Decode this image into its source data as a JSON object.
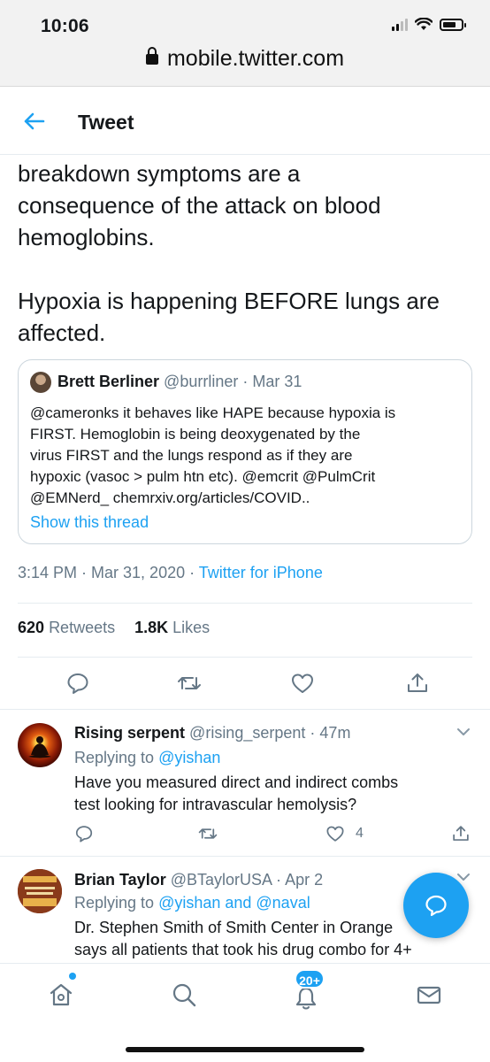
{
  "status_bar": {
    "time": "10:06"
  },
  "browser": {
    "url": "mobile.twitter.com"
  },
  "header": {
    "title": "Tweet"
  },
  "tweet": {
    "text": "breakdown symptoms are a\nconsequence of the attack on blood\nhemoglobins.\n\nHypoxia is happening BEFORE lungs are\naffected.",
    "quote": {
      "name": "Brett Berliner",
      "handle": "@burrliner",
      "date": "Mar 31",
      "text": "@cameronks it behaves like HAPE because hypoxia is\nFIRST.  Hemoglobin is being deoxygenated by the\nvirus FIRST and the lungs respond as if they are\nhypoxic (vasoc > pulm htn etc).  @emcrit @PulmCrit\n@EMNerd_ chemrxiv.org/articles/COVID..",
      "show_thread": "Show this thread"
    },
    "timestamp": "3:14 PM · Mar 31, 2020 · ",
    "source": "Twitter for iPhone",
    "retweets_count": "620",
    "retweets_label": "Retweets",
    "likes_count": "1.8K",
    "likes_label": "Likes"
  },
  "replies": [
    {
      "name": "Rising serpent",
      "handle": "@rising_serpent",
      "time": "47m",
      "replying_prefix": "Replying to ",
      "replying_to": "@yishan",
      "text": "Have you measured direct and indirect combs\ntest looking for intravascular hemolysis?",
      "likes": "4"
    },
    {
      "name": "Brian Taylor",
      "handle": "@BTaylorUSA",
      "time": "Apr 2",
      "replying_prefix": "Replying to ",
      "replying_to": "@yishan and @naval",
      "text": "Dr. Stephen Smith of Smith Center in Orange\nsays all patients that took his drug combo for 4+"
    }
  ],
  "bottom_nav": {
    "notifications_badge": "20+"
  },
  "colors": {
    "accent": "#1da1f2",
    "muted": "#657786",
    "text": "#14171a"
  },
  "icons": [
    "back-arrow-icon",
    "reply-icon",
    "retweet-icon",
    "like-icon",
    "share-icon",
    "chevron-down-icon",
    "home-icon",
    "search-icon",
    "bell-icon",
    "mail-icon",
    "compose-icon",
    "lock-icon"
  ]
}
